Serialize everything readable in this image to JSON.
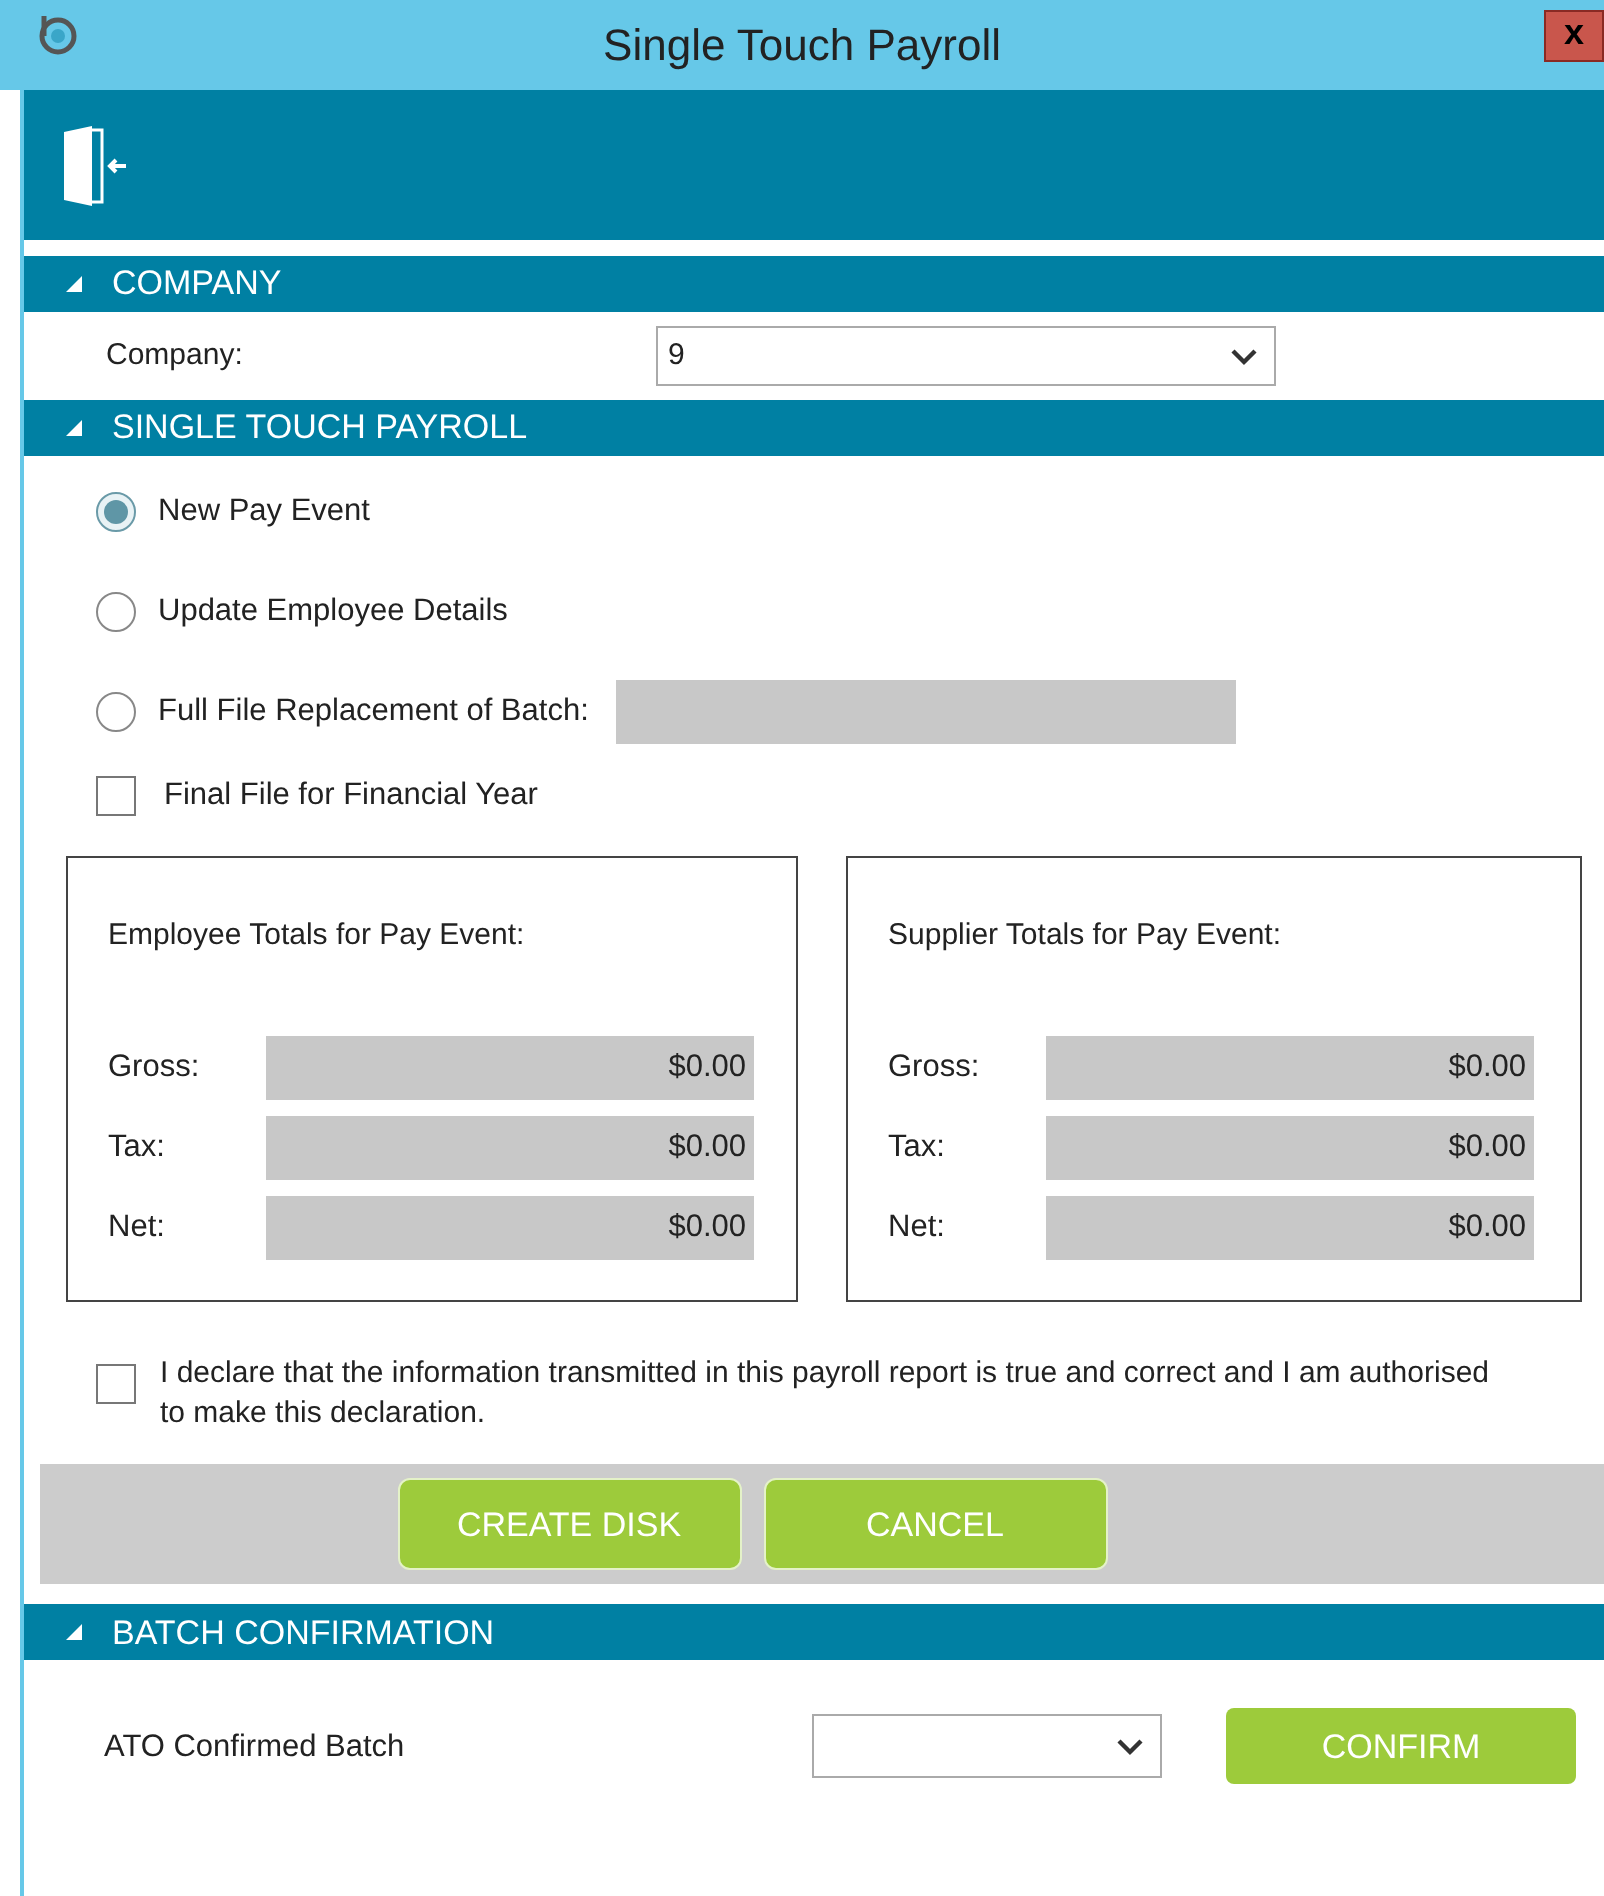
{
  "window": {
    "title": "Single Touch Payroll",
    "close_label": "x"
  },
  "company_section": {
    "title": "COMPANY",
    "expanded": true,
    "label": "Company:",
    "value": "9"
  },
  "stp_section": {
    "title": "SINGLE TOUCH PAYROLL",
    "expanded": true,
    "options": [
      {
        "label": "New Pay Event",
        "selected": true
      },
      {
        "label": "Update Employee Details",
        "selected": false
      },
      {
        "label": "Full File Replacement of Batch:",
        "selected": false,
        "kind": "with_field"
      }
    ],
    "final_file": {
      "label": "Final File for Financial Year",
      "checked": false
    },
    "panels": [
      {
        "title": "Employee Totals for Pay Event:",
        "rows": [
          {
            "label": "Gross:",
            "value": "$0.00"
          },
          {
            "label": "Tax:",
            "value": "$0.00"
          },
          {
            "label": "Net:",
            "value": "$0.00"
          }
        ]
      },
      {
        "title": "Supplier Totals for Pay Event:",
        "rows": [
          {
            "label": "Gross:",
            "value": "$0.00"
          },
          {
            "label": "Tax:",
            "value": "$0.00"
          },
          {
            "label": "Net:",
            "value": "$0.00"
          }
        ]
      }
    ],
    "declaration": {
      "label": "I declare that the information transmitted in this payroll report is true and correct and I am authorised to make this declaration.",
      "checked": false
    },
    "buttons": [
      "CREATE DISK",
      "CANCEL"
    ]
  },
  "batch_section": {
    "title": "BATCH CONFIRMATION",
    "expanded": true,
    "label": "ATO Confirmed Batch",
    "button": "CONFIRM"
  }
}
